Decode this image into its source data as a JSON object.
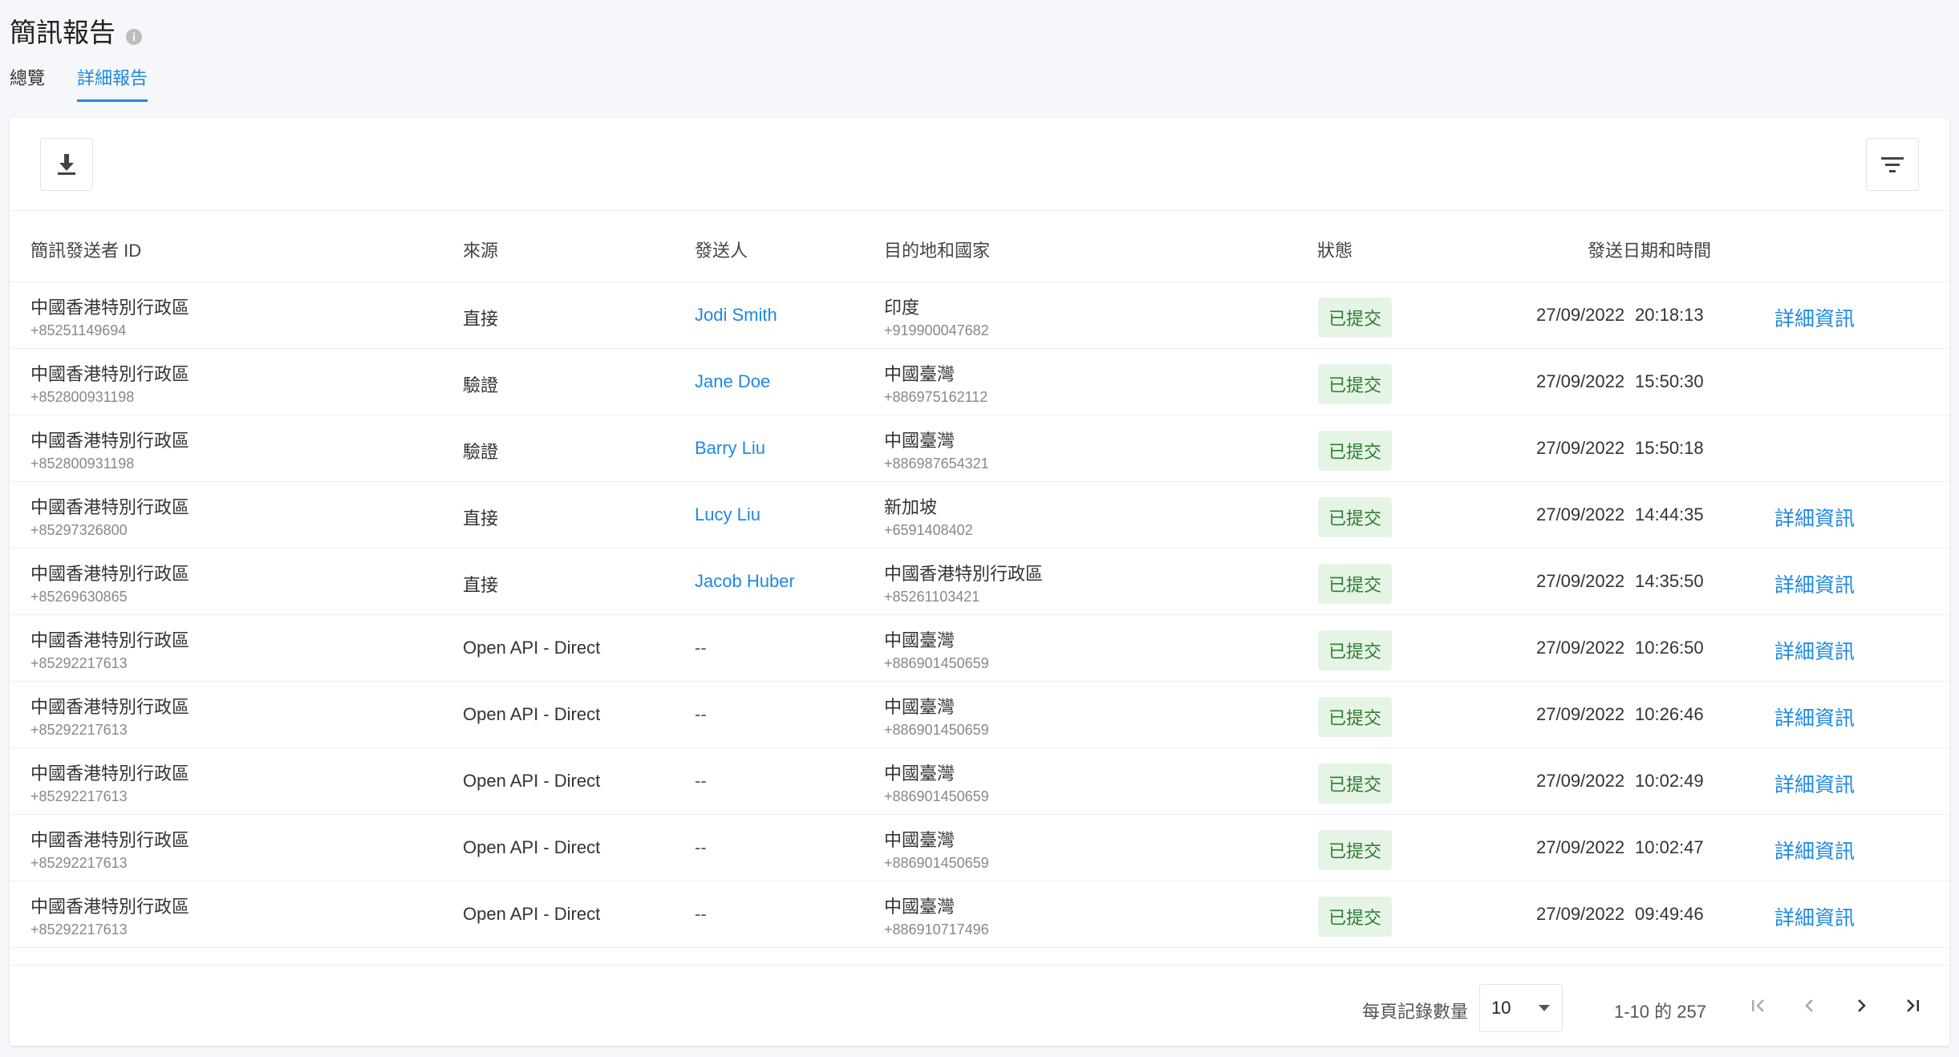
{
  "header": {
    "title": "簡訊報告"
  },
  "tabs": [
    {
      "label": "總覽",
      "active": false
    },
    {
      "label": "詳細報告",
      "active": true
    }
  ],
  "icons": {
    "info": "info-icon",
    "download": "download-icon",
    "filter": "filter-icon"
  },
  "colors": {
    "accent": "#1e88e5",
    "status_bg": "#e6f4e6",
    "status_text": "#2e7d32"
  },
  "table": {
    "columns": [
      "簡訊發送者 ID",
      "來源",
      "發送人",
      "目的地和國家",
      "狀態",
      "發送日期和時間"
    ],
    "rows": [
      {
        "sender_region": "中國香港特別行政區",
        "sender_phone": "+85251149694",
        "source": "直接",
        "sender": "Jodi Smith",
        "dest_country": "印度",
        "dest_phone": "+919900047682",
        "status": "已提交",
        "date": "27/09/2022",
        "time": "20:18:13",
        "link": "詳細資訊"
      },
      {
        "sender_region": "中國香港特別行政區",
        "sender_phone": "+852800931198",
        "source": "驗證",
        "sender": "Jane Doe",
        "dest_country": "中國臺灣",
        "dest_phone": "+886975162112",
        "status": "已提交",
        "date": "27/09/2022",
        "time": "15:50:30",
        "link": ""
      },
      {
        "sender_region": "中國香港特別行政區",
        "sender_phone": "+852800931198",
        "source": "驗證",
        "sender": "Barry Liu",
        "dest_country": "中國臺灣",
        "dest_phone": "+886987654321",
        "status": "已提交",
        "date": "27/09/2022",
        "time": "15:50:18",
        "link": ""
      },
      {
        "sender_region": "中國香港特別行政區",
        "sender_phone": "+85297326800",
        "source": "直接",
        "sender": "Lucy Liu",
        "dest_country": "新加坡",
        "dest_phone": "+6591408402",
        "status": "已提交",
        "date": "27/09/2022",
        "time": "14:44:35",
        "link": "詳細資訊"
      },
      {
        "sender_region": "中國香港特別行政區",
        "sender_phone": "+85269630865",
        "source": "直接",
        "sender": "Jacob Huber",
        "dest_country": "中國香港特別行政區",
        "dest_phone": "+85261103421",
        "status": "已提交",
        "date": "27/09/2022",
        "time": "14:35:50",
        "link": "詳細資訊"
      },
      {
        "sender_region": "中國香港特別行政區",
        "sender_phone": "+85292217613",
        "source": "Open API - Direct",
        "sender": "--",
        "dest_country": "中國臺灣",
        "dest_phone": "+886901450659",
        "status": "已提交",
        "date": "27/09/2022",
        "time": "10:26:50",
        "link": "詳細資訊"
      },
      {
        "sender_region": "中國香港特別行政區",
        "sender_phone": "+85292217613",
        "source": "Open API - Direct",
        "sender": "--",
        "dest_country": "中國臺灣",
        "dest_phone": "+886901450659",
        "status": "已提交",
        "date": "27/09/2022",
        "time": "10:26:46",
        "link": "詳細資訊"
      },
      {
        "sender_region": "中國香港特別行政區",
        "sender_phone": "+85292217613",
        "source": "Open API - Direct",
        "sender": "--",
        "dest_country": "中國臺灣",
        "dest_phone": "+886901450659",
        "status": "已提交",
        "date": "27/09/2022",
        "time": "10:02:49",
        "link": "詳細資訊"
      },
      {
        "sender_region": "中國香港特別行政區",
        "sender_phone": "+85292217613",
        "source": "Open API - Direct",
        "sender": "--",
        "dest_country": "中國臺灣",
        "dest_phone": "+886901450659",
        "status": "已提交",
        "date": "27/09/2022",
        "time": "10:02:47",
        "link": "詳細資訊"
      },
      {
        "sender_region": "中國香港特別行政區",
        "sender_phone": "+85292217613",
        "source": "Open API - Direct",
        "sender": "--",
        "dest_country": "中國臺灣",
        "dest_phone": "+886910717496",
        "status": "已提交",
        "date": "27/09/2022",
        "time": "09:49:46",
        "link": "詳細資訊"
      }
    ]
  },
  "pagination": {
    "rows_per_page_label": "每頁記錄數量",
    "rows_per_page": "10",
    "range": "1-10 的 257",
    "icons": [
      "first-page-icon",
      "prev-page-icon",
      "next-page-icon",
      "last-page-icon"
    ]
  }
}
